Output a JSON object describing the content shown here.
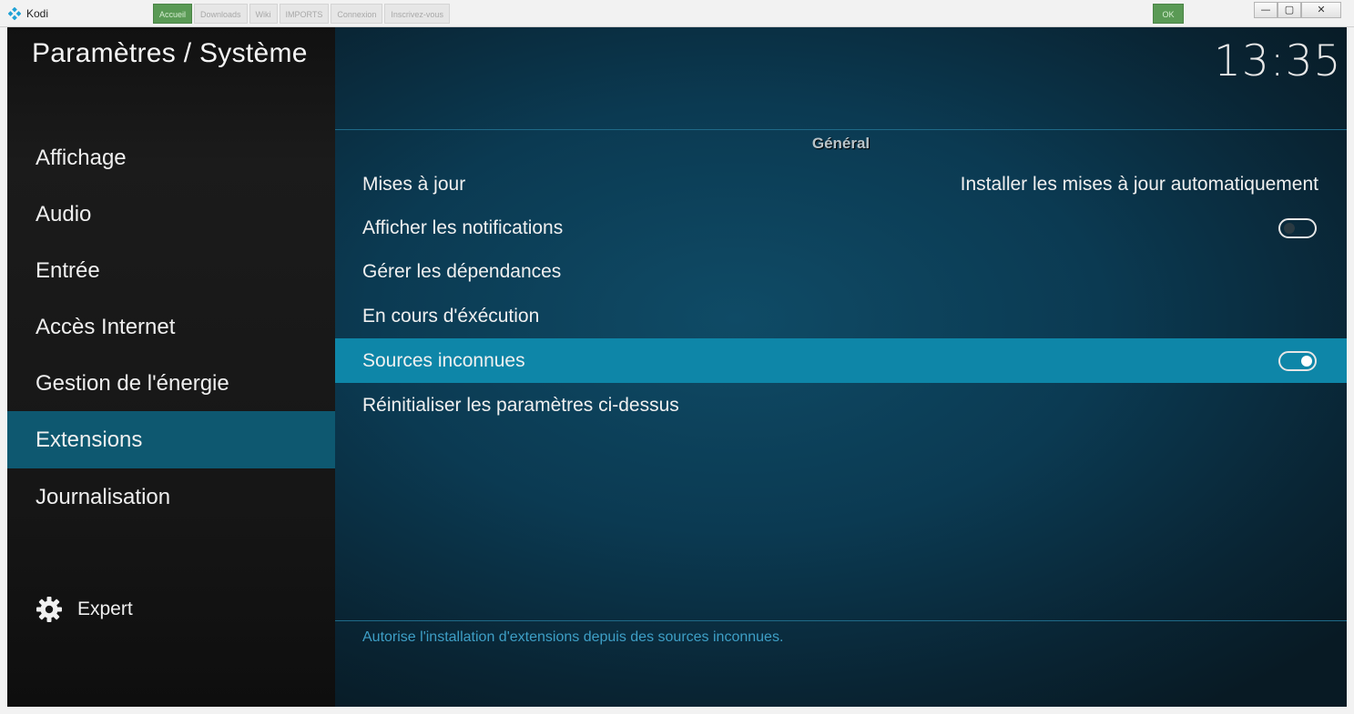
{
  "window": {
    "title": "Kodi",
    "controls": {
      "minimize": "—",
      "maximize": "▢",
      "close": "✕"
    },
    "background_tabs": [
      "Accueil",
      "Downloads",
      "Wiki",
      "IMPORTS",
      "Connexion",
      "Inscrivez-vous"
    ],
    "background_right": "OK"
  },
  "header": {
    "title": "Paramètres / Système",
    "clock": "13:35"
  },
  "sidebar": {
    "items": [
      {
        "label": "Affichage",
        "selected": false
      },
      {
        "label": "Audio",
        "selected": false
      },
      {
        "label": "Entrée",
        "selected": false
      },
      {
        "label": "Accès Internet",
        "selected": false
      },
      {
        "label": "Gestion de l'énergie",
        "selected": false
      },
      {
        "label": "Extensions",
        "selected": true
      },
      {
        "label": "Journalisation",
        "selected": false
      }
    ],
    "expert": {
      "label": "Expert",
      "icon": "gear-icon"
    }
  },
  "main": {
    "section": "Général",
    "settings": [
      {
        "label": "Mises à jour",
        "value": "Installer les mises à jour automatiquement"
      },
      {
        "label": "Afficher les notifications",
        "toggle": false
      },
      {
        "label": "Gérer les dépendances"
      },
      {
        "label": "En cours d'éxécution"
      },
      {
        "label": "Sources inconnues",
        "toggle": true,
        "focused": true
      },
      {
        "label": "Réinitialiser les paramètres ci-dessus"
      }
    ],
    "description": "Autorise l'installation d'extensions depuis des sources inconnues."
  },
  "colors": {
    "sidebar_selected": "#0e5870",
    "row_focused": "#0e86a8",
    "description_text": "#3e9fc6",
    "divider": "#1f6a88"
  }
}
